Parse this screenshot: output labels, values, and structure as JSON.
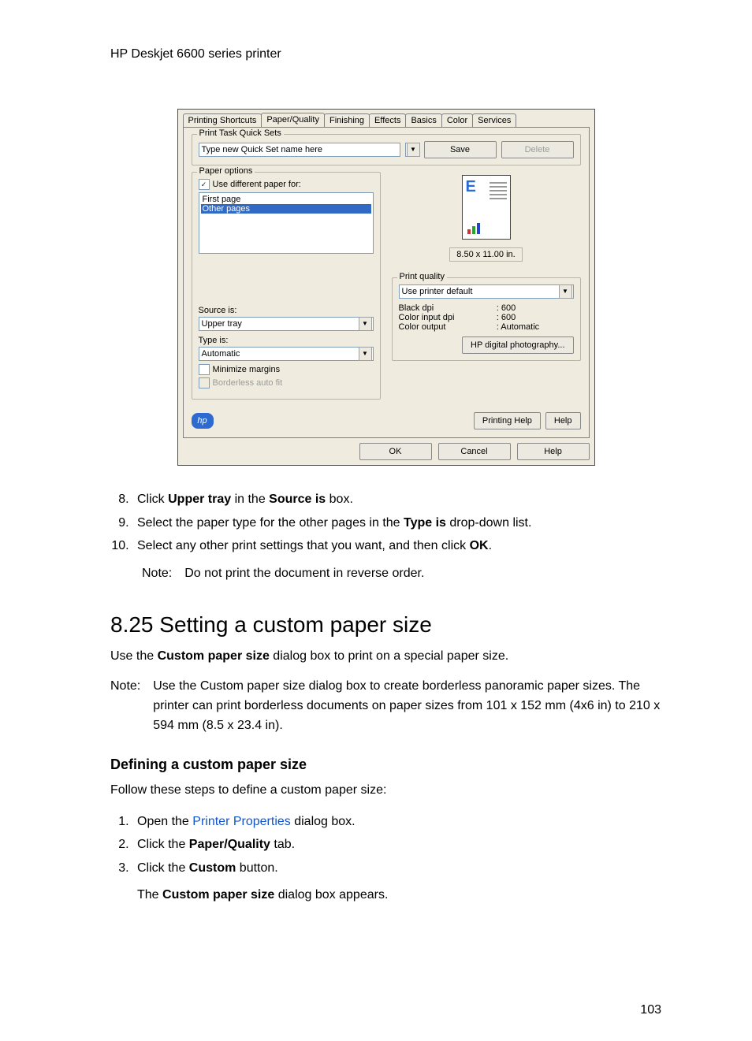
{
  "header": {
    "title": "HP Deskjet 6600 series printer"
  },
  "dialog": {
    "tabs": [
      "Printing Shortcuts",
      "Paper/Quality",
      "Finishing",
      "Effects",
      "Basics",
      "Color",
      "Services"
    ],
    "active_tab_index": 1,
    "quick_sets": {
      "title": "Print Task Quick Sets",
      "input_value": "Type new Quick Set name here",
      "save": "Save",
      "delete": "Delete"
    },
    "paper_options": {
      "title": "Paper options",
      "use_different_label": "Use different paper for:",
      "use_different_checked": true,
      "list_items": [
        "First page",
        "Other pages"
      ],
      "list_selected_index": 1,
      "source_label": "Source is:",
      "source_value": "Upper tray",
      "type_label": "Type is:",
      "type_value": "Automatic",
      "minimize_label": "Minimize margins",
      "minimize_checked": false,
      "borderless_label": "Borderless auto fit",
      "borderless_disabled": true
    },
    "preview": {
      "size_text": "8.50 x 11.00 in."
    },
    "print_quality": {
      "title": "Print quality",
      "combo_value": "Use printer default",
      "black_dpi_label": "Black dpi",
      "black_dpi_value": ": 600",
      "color_input_dpi_label": "Color input dpi",
      "color_input_dpi_value": ": 600",
      "color_output_label": "Color output",
      "color_output_value": ": Automatic",
      "hp_digital_btn": "HP digital photography..."
    },
    "footer": {
      "printing_help": "Printing Help",
      "help": "Help",
      "ok": "OK",
      "cancel": "Cancel",
      "help2": "Help"
    }
  },
  "steps_a": {
    "s8_a": "Click ",
    "s8_b": "Upper tray",
    "s8_c": " in the ",
    "s8_d": "Source is",
    "s8_e": " box.",
    "s9_a": "Select the paper type for the other pages in the ",
    "s9_b": "Type is",
    "s9_c": " drop-down list.",
    "s10_a": "Select any other print settings that you want, and then click ",
    "s10_b": "OK",
    "s10_c": "."
  },
  "note1": {
    "label": "Note:",
    "body": "Do not print the document in reverse order."
  },
  "section": {
    "title": "8.25  Setting a custom paper size"
  },
  "para1_a": "Use the ",
  "para1_b": "Custom paper size",
  "para1_c": " dialog box to print on a special paper size.",
  "note2": {
    "label": "Note:",
    "body": "Use the Custom paper size dialog box to create borderless panoramic paper sizes. The printer can print borderless documents on paper sizes from 101 x 152 mm (4x6 in) to 210 x 594 mm (8.5 x 23.4 in)."
  },
  "subheading": "Defining a custom paper size",
  "para2": "Follow these steps to define a custom paper size:",
  "steps_b": {
    "s1_a": "Open the ",
    "s1_link": "Printer Properties",
    "s1_b": " dialog box.",
    "s2_a": "Click the ",
    "s2_b": "Paper/Quality",
    "s2_c": " tab.",
    "s3_a": "Click the ",
    "s3_b": "Custom",
    "s3_c": " button.",
    "s3_extra_a": "The ",
    "s3_extra_b": "Custom paper size",
    "s3_extra_c": " dialog box appears."
  },
  "page_number": "103"
}
